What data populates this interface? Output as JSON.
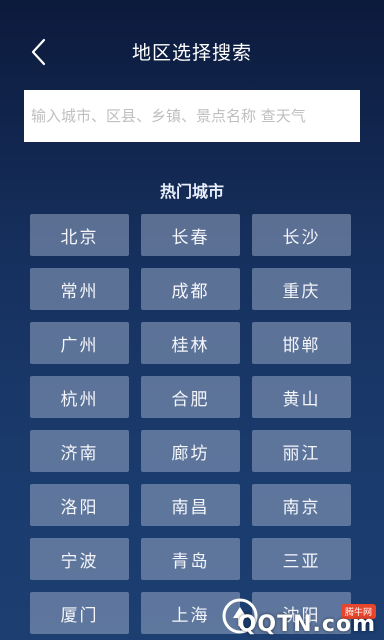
{
  "header": {
    "title": "地区选择搜索",
    "back_icon": "chevron-left-icon"
  },
  "search": {
    "placeholder": "输入城市、区县、乡镇、景点名称 查天气",
    "value": ""
  },
  "hot_cities": {
    "title": "热门城市",
    "items": [
      "北京",
      "长春",
      "长沙",
      "常州",
      "成都",
      "重庆",
      "广州",
      "桂林",
      "邯郸",
      "杭州",
      "合肥",
      "黄山",
      "济南",
      "廊坊",
      "丽江",
      "洛阳",
      "南昌",
      "南京",
      "宁波",
      "青岛",
      "三亚",
      "厦门",
      "上海",
      "沈阳"
    ]
  },
  "watermark": {
    "badge": "腾牛网",
    "text": "QQTN.com"
  },
  "colors": {
    "background_top": "#0c1a3c",
    "background_bottom": "#1c3e70",
    "tile": "rgba(150,165,195,0.55)",
    "watermark_badge": "#e8452c"
  }
}
